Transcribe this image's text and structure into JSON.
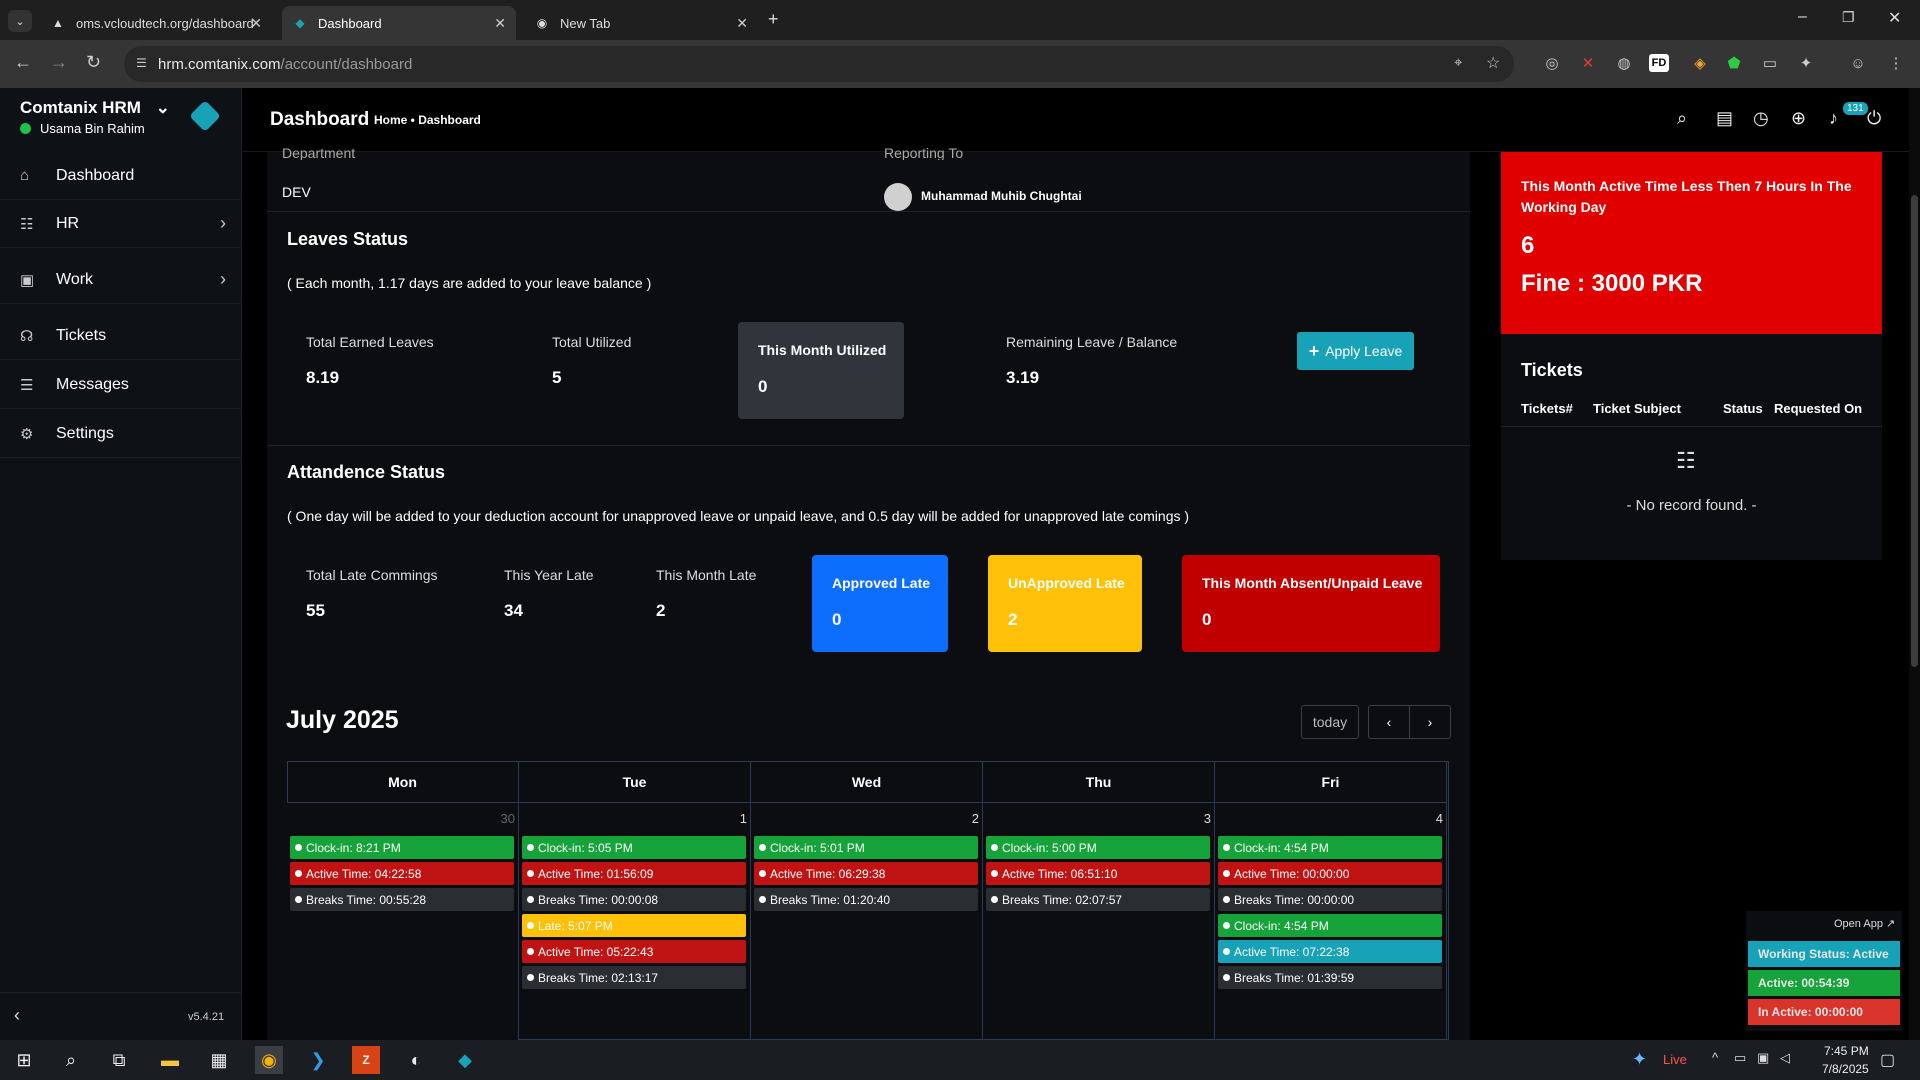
{
  "browser": {
    "tabs": [
      {
        "label": "oms.vcloudtech.org/dashboard"
      },
      {
        "label": "Dashboard"
      },
      {
        "label": "New Tab"
      }
    ],
    "url_host": "hrm.comtanix.com",
    "url_path": "/account/dashboard"
  },
  "sidebar": {
    "brand": "Comtanix HRM",
    "user": "Usama Bin Rahim",
    "items": [
      {
        "label": "Dashboard"
      },
      {
        "label": "HR"
      },
      {
        "label": "Work"
      },
      {
        "label": "Tickets"
      },
      {
        "label": "Messages"
      },
      {
        "label": "Settings"
      }
    ],
    "version": "v5.4.21"
  },
  "header": {
    "title": "Dashboard",
    "breadcrumb": "Home • Dashboard",
    "notif_count": "131"
  },
  "profile": {
    "department_label": "Department",
    "department_value": "DEV",
    "reporting_label": "Reporting To",
    "reporting_value": "Muhammad Muhib Chughtai"
  },
  "leaves": {
    "title": "Leaves Status",
    "note": "( Each month, 1.17 days are added to your leave balance )",
    "total_earned_label": "Total Earned Leaves",
    "total_earned_value": "8.19",
    "total_utilized_label": "Total Utilized",
    "total_utilized_value": "5",
    "month_utilized_label": "This Month Utilized",
    "month_utilized_value": "0",
    "remaining_label": "Remaining Leave / Balance",
    "remaining_value": "3.19",
    "apply_button": "Apply Leave"
  },
  "attendance": {
    "title": "Attandence Status",
    "note": "( One day will be added to your deduction account for unapproved leave or unpaid leave, and 0.5 day will be added for unapproved late comings )",
    "total_late_label": "Total Late Commings",
    "total_late_value": "55",
    "year_late_label": "This Year Late",
    "year_late_value": "34",
    "month_late_label": "This Month Late",
    "month_late_value": "2",
    "approved_label": "Approved Late",
    "approved_value": "0",
    "unapproved_label": "UnApproved Late",
    "unapproved_value": "2",
    "absent_label": "This Month Absent/Unpaid Leave",
    "absent_value": "0"
  },
  "calendar": {
    "title": "July 2025",
    "today_button": "today",
    "days": [
      {
        "name": "Mon",
        "num": "30",
        "events": [
          {
            "type": "green",
            "text": "Clock-in: 8:21 PM"
          },
          {
            "type": "red",
            "text": "Active Time: 04:22:58"
          },
          {
            "type": "gray",
            "text": "Breaks Time: 00:55:28"
          }
        ]
      },
      {
        "name": "Tue",
        "num": "1",
        "events": [
          {
            "type": "green",
            "text": "Clock-in: 5:05 PM"
          },
          {
            "type": "red",
            "text": "Active Time: 01:56:09"
          },
          {
            "type": "gray",
            "text": "Breaks Time: 00:00:08"
          },
          {
            "type": "yellow",
            "text": "Late: 5:07 PM"
          },
          {
            "type": "red",
            "text": "Active Time: 05:22:43"
          },
          {
            "type": "gray",
            "text": "Breaks Time: 02:13:17"
          }
        ]
      },
      {
        "name": "Wed",
        "num": "2",
        "events": [
          {
            "type": "green",
            "text": "Clock-in: 5:01 PM"
          },
          {
            "type": "red",
            "text": "Active Time: 06:29:38"
          },
          {
            "type": "gray",
            "text": "Breaks Time: 01:20:40"
          }
        ]
      },
      {
        "name": "Thu",
        "num": "3",
        "events": [
          {
            "type": "green",
            "text": "Clock-in: 5:00 PM"
          },
          {
            "type": "red",
            "text": "Active Time: 06:51:10"
          },
          {
            "type": "gray",
            "text": "Breaks Time: 02:07:57"
          }
        ]
      },
      {
        "name": "Fri",
        "num": "4",
        "events": [
          {
            "type": "green",
            "text": "Clock-in: 4:54 PM"
          },
          {
            "type": "red",
            "text": "Active Time: 00:00:00"
          },
          {
            "type": "gray",
            "text": "Breaks Time: 00:00:00"
          },
          {
            "type": "green",
            "text": "Clock-in: 4:54 PM"
          },
          {
            "type": "teal",
            "text": "Active Time: 07:22:38"
          },
          {
            "type": "gray",
            "text": "Breaks Time: 01:39:59"
          }
        ]
      }
    ]
  },
  "fine": {
    "message": "This Month Active Time Less Then 7 Hours In The Working Day",
    "count": "6",
    "amount": "Fine : 3000 PKR"
  },
  "tickets": {
    "title": "Tickets",
    "columns": [
      "Tickets#",
      "Ticket Subject",
      "Status",
      "Requested On"
    ],
    "empty": "- No record found. -"
  },
  "widget": {
    "open_app": "Open App ↗",
    "status": "Working Status: Active",
    "active": "Active: 00:54:39",
    "inactive": "In Active: 00:00:00"
  },
  "taskbar": {
    "live": "Live",
    "time": "7:45 PM",
    "date": "7/8/2025"
  },
  "colors": {
    "approved": "#0d6efd",
    "unapproved": "#ffc107",
    "absent": "#c00000",
    "fine": "#e00000",
    "accent": "#17a2b8"
  }
}
